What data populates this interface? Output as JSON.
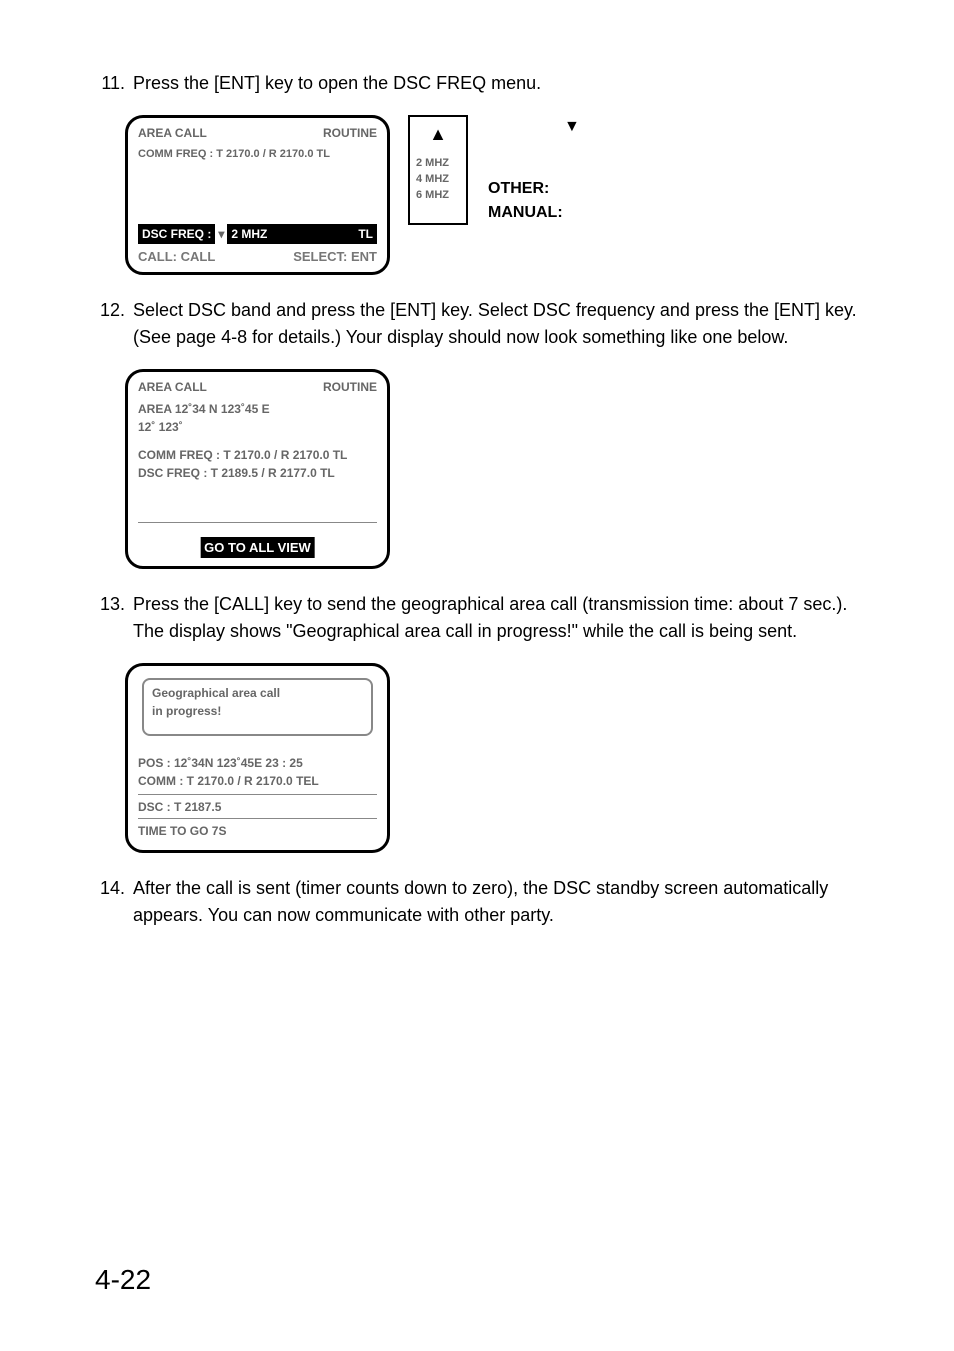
{
  "steps": {
    "s11": {
      "num": "11.",
      "text": "Press the [ENT] key to open the DSC FREQ menu."
    },
    "s12": {
      "num": "12.",
      "text": "Select DSC band and press the [ENT] key. Select DSC frequency and press the [ENT] key. (See page 4-8 for details.) Your display should now look something like one below."
    },
    "s13": {
      "num": "13.",
      "text": "Press the [CALL] key to send the geographical area call (transmission time: about 7 sec.). The display shows \"Geographical area call in progress!\" while the call is being sent."
    },
    "s14": {
      "num": "14.",
      "text": "After the call is sent (timer counts down to zero), the DSC standby screen automatically appears. You can now communicate with other party."
    }
  },
  "fig1": {
    "top_left": "AREA CALL",
    "top_right": "ROUTINE",
    "row2": "COMM FREQ    : T 2170.0 / R 2170.0 TL",
    "dsc_freq_label": "  DSC FREQ     : ",
    "dsc_freq_val": "2 MHZ",
    "dsc_freq_suffix": "                         TL",
    "bot_l": "CALL: CALL",
    "bot_r": "SELECT: ENT",
    "pop_up": "▲",
    "pop_l1": "2 MHZ",
    "pop_l2": "4 MHZ",
    "pop_l3": "6 MHZ",
    "right_dn": "▼",
    "right_b1": "OTHER:",
    "right_b2": "MANUAL:"
  },
  "fig2": {
    "top_l": "AREA CALL",
    "top_r": "ROUTINE",
    "l1": "AREA 12˚34   N     123˚45  E",
    "l2": "                  12˚              123˚",
    "l3": "COMM FREQ   : T 2170.0 / R 2170.0 TL",
    "l4": "DSC  FREQ    : T 2189.5 / R 2177.0 TL",
    "go": "GO TO ALL VIEW"
  },
  "fig3": {
    "box_l1": "Geographical area call",
    "box_l2": "in progress!",
    "l1": "POS : 12˚34N     123˚45E   23 : 25",
    "l2": "COMM : T 2170.0 / R 2170.0   TEL",
    "l3": "DSC  : T 2187.5",
    "l4": "TIME TO GO                       7S"
  },
  "pagefoot": "4-22"
}
